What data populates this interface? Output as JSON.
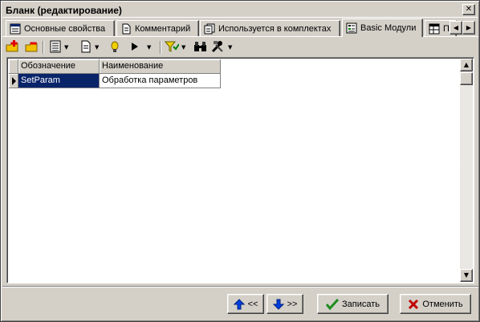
{
  "window": {
    "title": "Бланк (редактирование)",
    "close_symbol": "✕"
  },
  "tabs": [
    {
      "label": "Основные свойства",
      "icon": "properties-icon",
      "active": false
    },
    {
      "label": "Комментарий",
      "icon": "document-icon",
      "active": false
    },
    {
      "label": "Используется в комплектах",
      "icon": "sets-icon",
      "active": false
    },
    {
      "label": "Basic Модули",
      "icon": "module-icon",
      "active": true
    },
    {
      "label": "П",
      "icon": "table-icon",
      "active": false
    }
  ],
  "tab_scroll": {
    "left": "◀",
    "right": "▶"
  },
  "toolbar": {
    "items": [
      "add-folder-icon",
      "remove-folder-icon",
      "list-view-icon",
      "page-icon",
      "yellow-pin-icon",
      "play-icon",
      "filter-icon",
      "binoculars-icon",
      "tools-icon"
    ],
    "dropdown_symbol": "▼"
  },
  "grid": {
    "columns": [
      "Обозначение",
      "Наименование"
    ],
    "rows": [
      {
        "designation": "SetParam",
        "name": "Обработка параметров",
        "selected": true
      }
    ]
  },
  "scrollbar": {
    "up": "▲",
    "down": "▼"
  },
  "buttons": {
    "prev_label": "<<",
    "next_label": ">>",
    "save_label": "Записать",
    "cancel_label": "Отменить"
  },
  "colors": {
    "face": "#d4d0c8",
    "selection": "#0a246a",
    "accent_blue": "#0040e0",
    "ok_green": "#1e8c1e",
    "cancel_red": "#c00000"
  }
}
